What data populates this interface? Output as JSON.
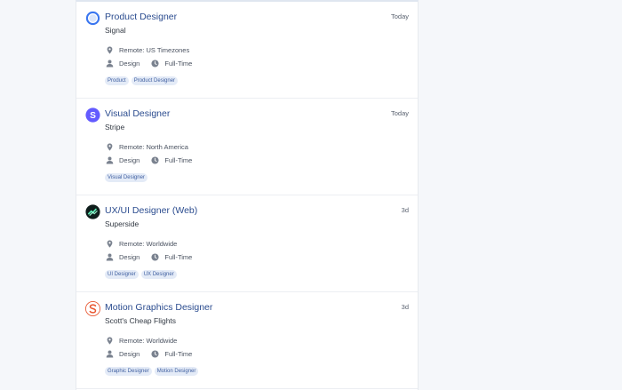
{
  "jobs": [
    {
      "title": "Product Designer",
      "company": "Signal",
      "date": "Today",
      "location_label": "Remote:",
      "location": "US Timezones",
      "category": "Design",
      "type": "Full-Time",
      "tags": [
        "Product",
        "Product Designer"
      ],
      "logo_icon": "signal-logo-icon",
      "logo_color": "#3a76f0"
    },
    {
      "title": "Visual Designer",
      "company": "Stripe",
      "date": "Today",
      "location_label": "Remote:",
      "location": "North America",
      "category": "Design",
      "type": "Full-Time",
      "tags": [
        "Visual Designer"
      ],
      "logo_icon": "stripe-logo-icon",
      "logo_color": "#635bff"
    },
    {
      "title": "UX/UI Designer (Web)",
      "company": "Superside",
      "date": "3d",
      "location_label": "Remote:",
      "location": "Worldwide",
      "category": "Design",
      "type": "Full-Time",
      "tags": [
        "UI Designer",
        "UX Designer"
      ],
      "logo_icon": "superside-logo-icon",
      "logo_color": "#0f1e1c"
    },
    {
      "title": "Motion Graphics Designer",
      "company": "Scott's Cheap Flights",
      "date": "3d",
      "location_label": "Remote:",
      "location": "Worldwide",
      "category": "Design",
      "type": "Full-Time",
      "tags": [
        "Graphic Designer",
        "Motion Designer"
      ],
      "logo_icon": "scotts-cheap-flights-logo-icon",
      "logo_color": "#e8552f"
    }
  ]
}
